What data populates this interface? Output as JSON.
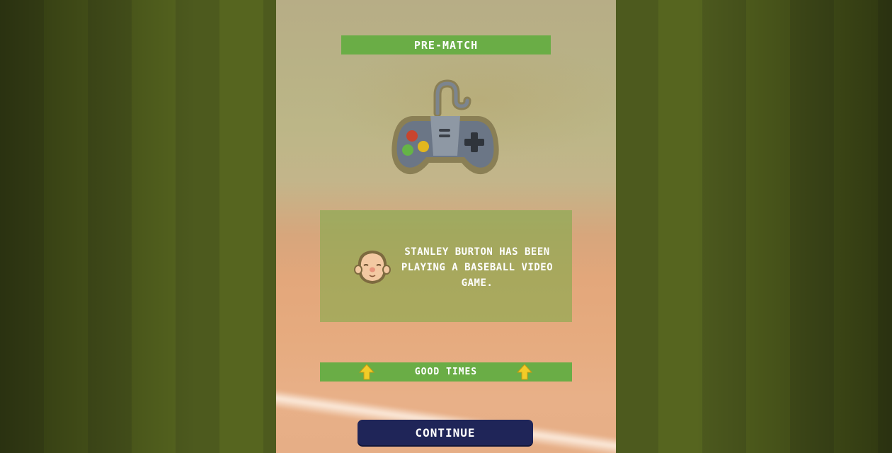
{
  "header": {
    "title": "PRE-MATCH"
  },
  "event": {
    "icon": "game-controller-icon",
    "character_icon": "bald-character-face-icon",
    "message": "Stanley Burton has been playing a baseball video game."
  },
  "mood": {
    "label": "GOOD TIMES",
    "icon": "arrow-up-icon",
    "arrow_color": "#f2cc28"
  },
  "actions": {
    "continue_label": "CONTINUE"
  },
  "colors": {
    "bar_green": "#6aad46",
    "button_navy": "#1f2558",
    "stripe_dark": "#4d5a1e",
    "stripe_light": "#56651f"
  }
}
